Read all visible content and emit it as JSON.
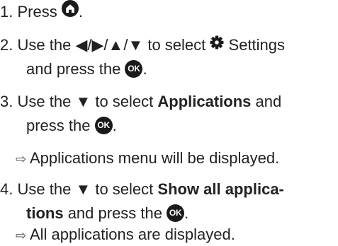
{
  "steps": [
    {
      "num": "1.",
      "press": "Press",
      "end": "."
    },
    {
      "num": "2.",
      "use_the": "Use the",
      "arrows": [
        "◀",
        "/",
        "▶",
        "/",
        "▲",
        "/",
        "▼"
      ],
      "to_select": "to select",
      "settings": "Settings",
      "and_press_the": "and press the",
      "ok": "OK",
      "end": "."
    },
    {
      "num": "3.",
      "use_the": "Use the",
      "down": "▼",
      "to_select": "to select",
      "target": "Applications",
      "and": "and",
      "press_the": "press the",
      "ok": "OK",
      "end": "."
    },
    {
      "num": "4.",
      "use_the": "Use the",
      "down": "▼",
      "to_select": "to select",
      "target_a": "Show all applica-",
      "target_b": "tions",
      "and_press_the": "and press the",
      "ok": "OK",
      "end": "."
    }
  ],
  "results": {
    "applications_menu": "Applications menu will be displayed.",
    "all_apps": "All applications are displayed."
  },
  "result_arrow": "⇨",
  "icons": {
    "home": "home-icon",
    "settings": "gear-icon",
    "ok": "ok-button-icon"
  }
}
